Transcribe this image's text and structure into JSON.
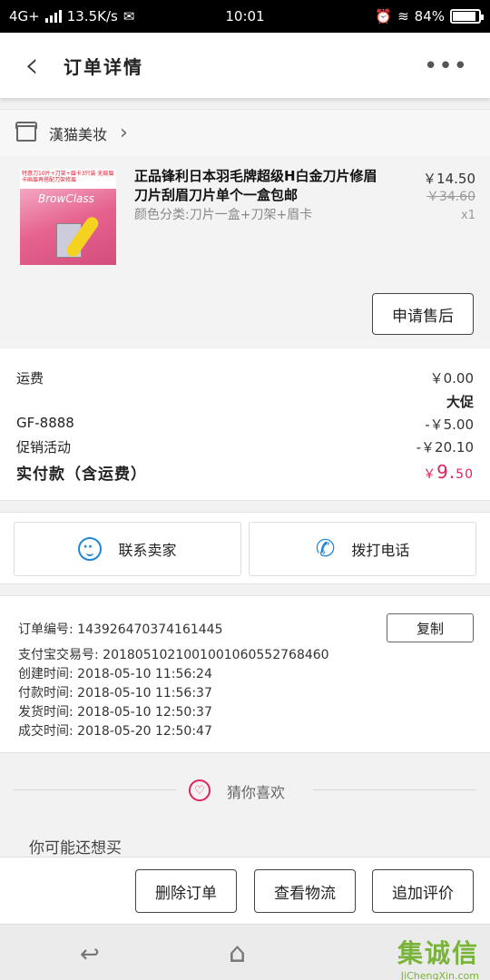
{
  "status_bar": {
    "network": "4G+",
    "speed": "13.5K/s",
    "time": "10:01",
    "battery": "84%"
  },
  "header": {
    "back_glyph": "‹",
    "title": "订单详情",
    "more_glyph": "•••"
  },
  "shop": {
    "name": "漢猫美妆",
    "chevron": "›"
  },
  "product": {
    "thumb_banner": "特惠刀10片+刀架+眉卡3只装 无痕眉卡画眉再搭配刀架修眉",
    "thumb_brand": "BrowClass",
    "title": "正品锋利日本羽毛牌超级H白金刀片修眉刀片刮眉刀片单个一盒包邮",
    "variant": "颜色分类:刀片一盒+刀架+眉卡",
    "price": "￥14.50",
    "original_price": "￥34.60",
    "quantity": "x1",
    "after_sale_label": "申请售后"
  },
  "fees": {
    "shipping_label": "运费",
    "shipping_value": "￥0.00",
    "promo_title": "大促",
    "coupon_label": "GF-8888",
    "coupon_value": "-￥5.00",
    "activity_label": "促销活动",
    "activity_value": "-￥20.10",
    "total_label": "实付款（含运费）",
    "total_currency": "￥",
    "total_int": "9.",
    "total_dec": "50"
  },
  "contact": {
    "seller_label": "联系卖家",
    "call_label": "拨打电话"
  },
  "order_info": {
    "order_no": "订单编号: 143926470374161445",
    "copy_label": "复制",
    "alipay_no": "支付宝交易号: 2018051021001001060552768460",
    "created": "创建时间: 2018-05-10 11:56:24",
    "paid": "付款时间: 2018-05-10 11:56:37",
    "shipped": "发货时间: 2018-05-10 12:50:37",
    "completed": "成交时间: 2018-05-20 12:50:47"
  },
  "guess": {
    "title": "猜你喜欢",
    "subtitle": "你可能还想买"
  },
  "actions": {
    "delete_label": "删除订单",
    "logistics_label": "查看物流",
    "review_label": "追加评价"
  },
  "watermark": {
    "top": "集诚信",
    "bottom": "JiChengXin.com"
  },
  "colors": {
    "accent_red": "#e3245c",
    "accent_blue": "#1e88d6"
  }
}
